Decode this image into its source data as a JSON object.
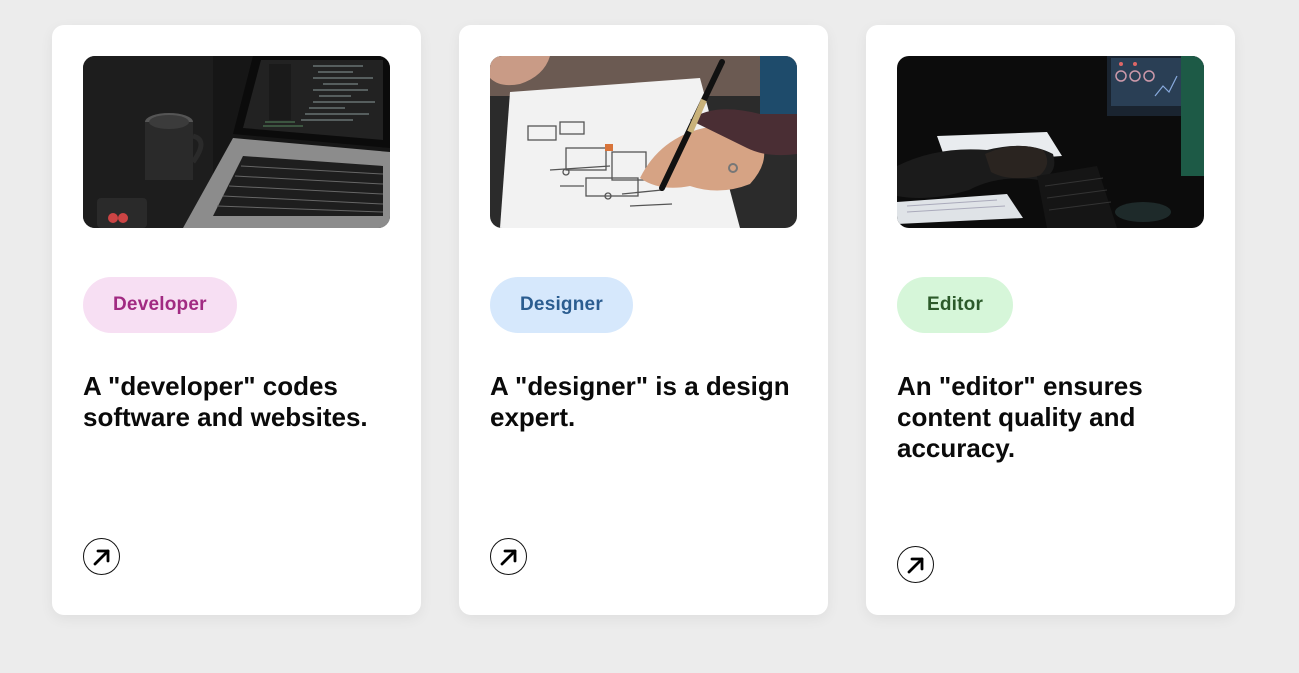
{
  "cards": [
    {
      "image_alt": "Laptop with code editor next to a camera lens mug",
      "badge": "Developer",
      "description": "A \"developer\" codes software and websites.",
      "link_icon": "arrow-up-right-icon"
    },
    {
      "image_alt": "Hand sketching wireframes on paper with a pen",
      "badge": "Designer",
      "description": "A \"designer\" is a design expert.",
      "link_icon": "arrow-up-right-icon"
    },
    {
      "image_alt": "Person typing on a keyboard in a dark room with monitors",
      "badge": "Editor",
      "description": "An \"editor\" ensures content quality and accuracy.",
      "link_icon": "arrow-up-right-icon"
    }
  ],
  "colors": {
    "background": "#ececec",
    "card": "#ffffff",
    "developer_badge_bg": "#f7dff3",
    "developer_badge_text": "#a12a82",
    "designer_badge_bg": "#d6e8fc",
    "designer_badge_text": "#2b5d90",
    "editor_badge_bg": "#d6f6d9",
    "editor_badge_text": "#2c5a2a"
  }
}
